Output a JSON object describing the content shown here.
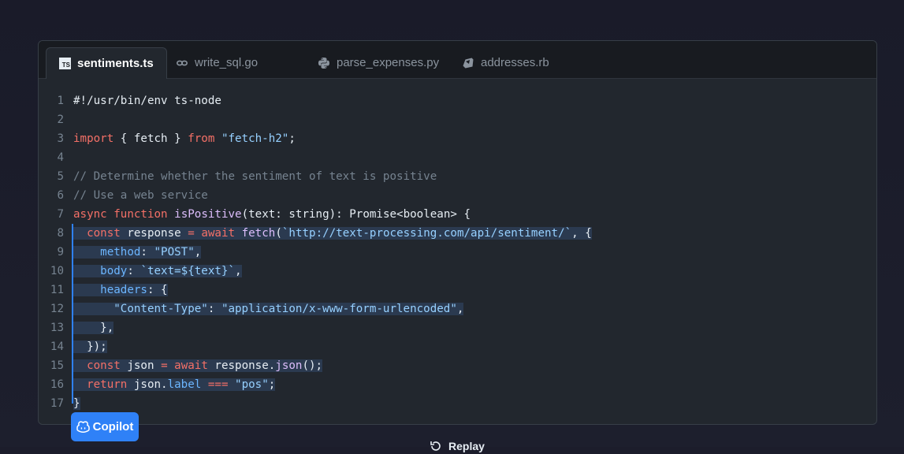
{
  "tabs": [
    {
      "label": "sentiments.ts",
      "icon": "typescript-icon",
      "active": true
    },
    {
      "label": "write_sql.go",
      "icon": "go-icon",
      "active": false
    },
    {
      "label": "parse_expenses.py",
      "icon": "python-icon",
      "active": false
    },
    {
      "label": "addresses.rb",
      "icon": "ruby-icon",
      "active": false
    }
  ],
  "ts_badge_text": "TS",
  "code": {
    "lines": [
      {
        "num": "1",
        "tokens": [
          [
            "plain",
            "#!/usr/bin/env ts-node"
          ]
        ]
      },
      {
        "num": "2",
        "tokens": []
      },
      {
        "num": "3",
        "tokens": [
          [
            "kw",
            "import"
          ],
          [
            "plain",
            " { fetch } "
          ],
          [
            "kw",
            "from"
          ],
          [
            "plain",
            " "
          ],
          [
            "str",
            "\"fetch-h2\""
          ],
          [
            "plain",
            ";"
          ]
        ]
      },
      {
        "num": "4",
        "tokens": []
      },
      {
        "num": "5",
        "tokens": [
          [
            "com",
            "// Determine whether the sentiment of text is positive"
          ]
        ]
      },
      {
        "num": "6",
        "tokens": [
          [
            "com",
            "// Use a web service"
          ]
        ]
      },
      {
        "num": "7",
        "tokens": [
          [
            "kw",
            "async"
          ],
          [
            "plain",
            " "
          ],
          [
            "kw",
            "function"
          ],
          [
            "plain",
            " "
          ],
          [
            "fn",
            "isPositive"
          ],
          [
            "plain",
            "(text: string): Promise<boolean> {"
          ]
        ]
      },
      {
        "num": "8",
        "hl": true,
        "tokens": [
          [
            "plain",
            "  "
          ],
          [
            "kw",
            "const"
          ],
          [
            "plain",
            " response "
          ],
          [
            "kw",
            "="
          ],
          [
            "plain",
            " "
          ],
          [
            "kw",
            "await"
          ],
          [
            "plain",
            " "
          ],
          [
            "fn",
            "fetch"
          ],
          [
            "plain",
            "("
          ],
          [
            "str",
            "`http://text-processing.com/api/sentiment/`"
          ],
          [
            "plain",
            ", {"
          ]
        ]
      },
      {
        "num": "9",
        "hl": true,
        "tokens": [
          [
            "plain",
            "    "
          ],
          [
            "prop",
            "method"
          ],
          [
            "plain",
            ": "
          ],
          [
            "str",
            "\"POST\""
          ],
          [
            "plain",
            ","
          ]
        ]
      },
      {
        "num": "10",
        "hl": true,
        "tokens": [
          [
            "plain",
            "    "
          ],
          [
            "prop",
            "body"
          ],
          [
            "plain",
            ": "
          ],
          [
            "str",
            "`text=${text}`"
          ],
          [
            "plain",
            ","
          ]
        ]
      },
      {
        "num": "11",
        "hl": true,
        "tokens": [
          [
            "plain",
            "    "
          ],
          [
            "prop",
            "headers"
          ],
          [
            "plain",
            ": {"
          ]
        ]
      },
      {
        "num": "12",
        "hl": true,
        "tokens": [
          [
            "plain",
            "      "
          ],
          [
            "str",
            "\"Content-Type\""
          ],
          [
            "plain",
            ": "
          ],
          [
            "str",
            "\"application/x-www-form-urlencoded\""
          ],
          [
            "plain",
            ","
          ]
        ]
      },
      {
        "num": "13",
        "hl": true,
        "tokens": [
          [
            "plain",
            "    },"
          ]
        ]
      },
      {
        "num": "14",
        "hl": true,
        "tokens": [
          [
            "plain",
            "  });"
          ]
        ]
      },
      {
        "num": "15",
        "hl": true,
        "tokens": [
          [
            "plain",
            "  "
          ],
          [
            "kw",
            "const"
          ],
          [
            "plain",
            " json "
          ],
          [
            "kw",
            "="
          ],
          [
            "plain",
            " "
          ],
          [
            "kw",
            "await"
          ],
          [
            "plain",
            " response."
          ],
          [
            "fn",
            "json"
          ],
          [
            "plain",
            "();"
          ]
        ]
      },
      {
        "num": "16",
        "hl": true,
        "tokens": [
          [
            "plain",
            "  "
          ],
          [
            "kw",
            "return"
          ],
          [
            "plain",
            " json."
          ],
          [
            "prop",
            "label"
          ],
          [
            "plain",
            " "
          ],
          [
            "kw",
            "==="
          ],
          [
            "plain",
            " "
          ],
          [
            "str",
            "\"pos\""
          ],
          [
            "plain",
            ";"
          ]
        ]
      },
      {
        "num": "17",
        "hl": true,
        "tokens": [
          [
            "plain",
            "}"
          ]
        ]
      }
    ]
  },
  "copilot_button": {
    "label": "Copilot",
    "icon": "copilot-icon"
  },
  "replay_button": {
    "label": "Replay",
    "icon": "replay-icon"
  },
  "colors": {
    "keyword": "#f47067",
    "string": "#96d0ff",
    "comment": "#768390",
    "function": "#dcbdfb",
    "property": "#6cb6ff",
    "accent": "#2f81f7",
    "selection": "#2b3a50"
  }
}
